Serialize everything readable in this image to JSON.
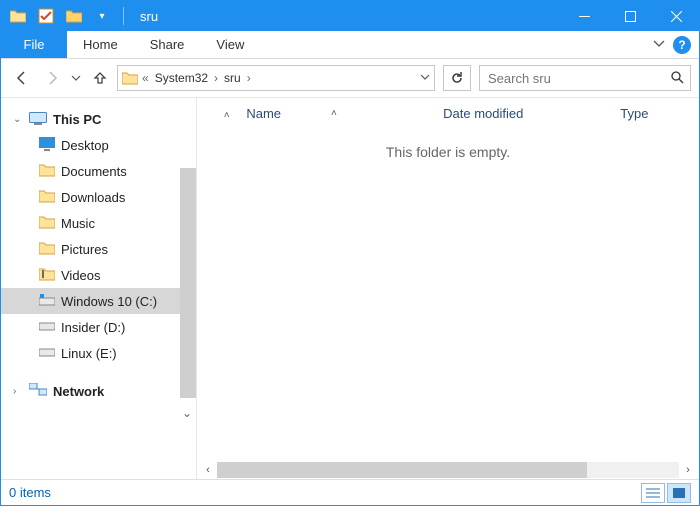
{
  "title": "sru",
  "tabs": {
    "file": "File",
    "home": "Home",
    "share": "Share",
    "view": "View"
  },
  "address": {
    "crumb1": "System32",
    "crumb2": "sru"
  },
  "search": {
    "placeholder": "Search sru"
  },
  "columns": {
    "name": "Name",
    "date": "Date modified",
    "type": "Type"
  },
  "empty_msg": "This folder is empty.",
  "tree": {
    "this_pc": "This PC",
    "desktop": "Desktop",
    "documents": "Documents",
    "downloads": "Downloads",
    "music": "Music",
    "pictures": "Pictures",
    "videos": "Videos",
    "cdrive": "Windows 10 (C:)",
    "ddrive": "Insider (D:)",
    "edrive": "Linux (E:)",
    "network": "Network"
  },
  "status": {
    "items": "0 items"
  }
}
